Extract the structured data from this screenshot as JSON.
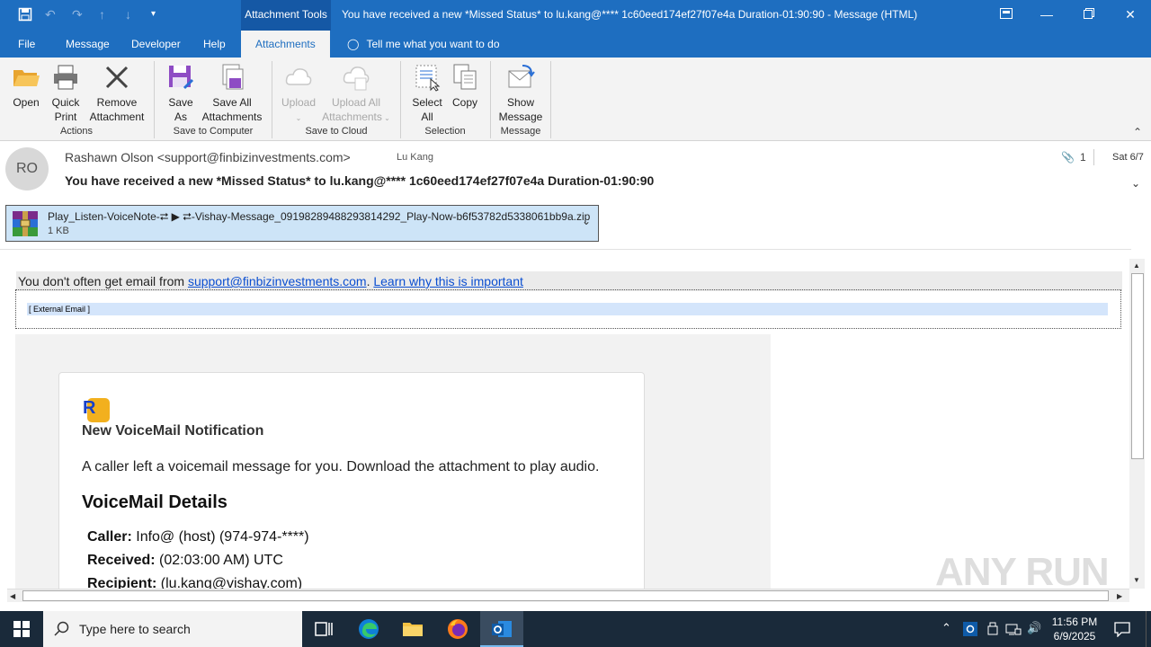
{
  "titlebar": {
    "context_tab_group": "Attachment Tools",
    "window_title": "You have received a new *Missed Status* to lu.kang@**** 1c60eed174ef27f07e4a Duration-01:90:90  -  Message (HTML)"
  },
  "tabs": [
    {
      "label": "File"
    },
    {
      "label": "Message"
    },
    {
      "label": "Developer"
    },
    {
      "label": "Help"
    },
    {
      "label": "Attachments",
      "active": true
    }
  ],
  "tell_me": "Tell me what you want to do",
  "ribbon": {
    "groups": [
      {
        "label": "Actions",
        "buttons": [
          "Open",
          "Quick Print",
          "Remove Attachment"
        ]
      },
      {
        "label": "Save to Computer",
        "buttons": [
          "Save As",
          "Save All Attachments"
        ]
      },
      {
        "label": "Save to Cloud",
        "buttons": [
          "Upload",
          "Upload All Attachments"
        ]
      },
      {
        "label": "Selection",
        "buttons": [
          "Select All",
          "Copy"
        ]
      },
      {
        "label": "Message",
        "buttons": [
          "Show Message"
        ]
      }
    ],
    "btn": {
      "open_1": "Open",
      "quick_1": "Quick",
      "quick_2": "Print",
      "remove_1": "Remove",
      "remove_2": "Attachment",
      "saveas_1": "Save",
      "saveas_2": "As",
      "saveall_1": "Save All",
      "saveall_2": "Attachments",
      "upload_1": "Upload",
      "uploadall_1": "Upload All",
      "uploadall_2": "Attachments",
      "selectall_1": "Select",
      "selectall_2": "All",
      "copy_1": "Copy",
      "show_1": "Show",
      "show_2": "Message"
    },
    "group_labels": {
      "actions": "Actions",
      "save_computer": "Save to Computer",
      "save_cloud": "Save to Cloud",
      "selection": "Selection",
      "message": "Message"
    }
  },
  "header": {
    "avatar_initials": "RO",
    "sender": "Rashawn Olson <support@finbizinvestments.com>",
    "to": "Lu Kang",
    "subject": "You have received a new *Missed Status* to lu.kang@**** 1c60eed174ef27f07e4a Duration-01:90:90",
    "attachment_count": "1",
    "date": "Sat 6/7"
  },
  "attachment": {
    "name": "Play_Listen-VoiceNote-⮂ ▶ ⮂-Vishay-Message_09198289488293814292_Play-Now-b6f53782d5338061bb9a.zip",
    "size": "1 KB"
  },
  "body": {
    "warning_prefix": "You don't often get email from ",
    "warning_email": "support@finbizinvestments.com",
    "warning_sep": ". ",
    "warning_link": "Learn why this is important",
    "external_tag": "[ External Email ]",
    "logo_letter": "R",
    "card_title": "New VoiceMail Notification",
    "card_message": "A caller left a voicemail message for you. Download the attachment to play audio.",
    "details_heading": "VoiceMail Details",
    "details": [
      {
        "label": "Caller:",
        "value": " Info@ (host) (974-974-****)"
      },
      {
        "label": "Received:",
        "value": " (02:03:00 AM) UTC"
      },
      {
        "label": "Recipient:",
        "value": " (lu.kang@vishay.com)"
      }
    ]
  },
  "watermark": "ANY RUN",
  "taskbar": {
    "search_placeholder": "Type here to search",
    "time": "11:56 PM",
    "date": "6/9/2025"
  },
  "colors": {
    "titlebar": "#1e6ec0",
    "ribbon_bg": "#f3f3f3",
    "attachment_bg": "#cde4f7",
    "link": "#0b4fd1",
    "taskbar": "#1a2a3a"
  }
}
